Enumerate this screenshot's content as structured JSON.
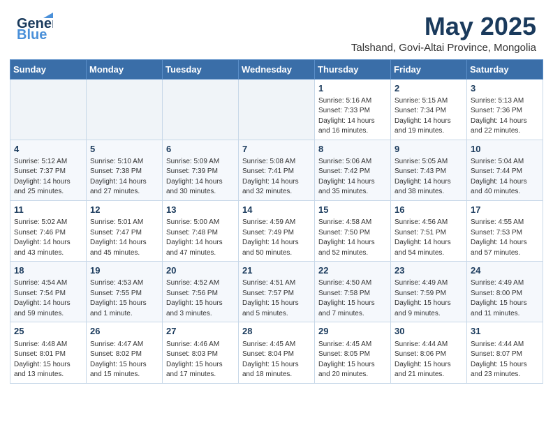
{
  "header": {
    "logo_general": "General",
    "logo_blue": "Blue",
    "month_title": "May 2025",
    "location": "Talshand, Govi-Altai Province, Mongolia"
  },
  "weekdays": [
    "Sunday",
    "Monday",
    "Tuesday",
    "Wednesday",
    "Thursday",
    "Friday",
    "Saturday"
  ],
  "weeks": [
    [
      {
        "day": "",
        "info": ""
      },
      {
        "day": "",
        "info": ""
      },
      {
        "day": "",
        "info": ""
      },
      {
        "day": "",
        "info": ""
      },
      {
        "day": "1",
        "info": "Sunrise: 5:16 AM\nSunset: 7:33 PM\nDaylight: 14 hours\nand 16 minutes."
      },
      {
        "day": "2",
        "info": "Sunrise: 5:15 AM\nSunset: 7:34 PM\nDaylight: 14 hours\nand 19 minutes."
      },
      {
        "day": "3",
        "info": "Sunrise: 5:13 AM\nSunset: 7:36 PM\nDaylight: 14 hours\nand 22 minutes."
      }
    ],
    [
      {
        "day": "4",
        "info": "Sunrise: 5:12 AM\nSunset: 7:37 PM\nDaylight: 14 hours\nand 25 minutes."
      },
      {
        "day": "5",
        "info": "Sunrise: 5:10 AM\nSunset: 7:38 PM\nDaylight: 14 hours\nand 27 minutes."
      },
      {
        "day": "6",
        "info": "Sunrise: 5:09 AM\nSunset: 7:39 PM\nDaylight: 14 hours\nand 30 minutes."
      },
      {
        "day": "7",
        "info": "Sunrise: 5:08 AM\nSunset: 7:41 PM\nDaylight: 14 hours\nand 32 minutes."
      },
      {
        "day": "8",
        "info": "Sunrise: 5:06 AM\nSunset: 7:42 PM\nDaylight: 14 hours\nand 35 minutes."
      },
      {
        "day": "9",
        "info": "Sunrise: 5:05 AM\nSunset: 7:43 PM\nDaylight: 14 hours\nand 38 minutes."
      },
      {
        "day": "10",
        "info": "Sunrise: 5:04 AM\nSunset: 7:44 PM\nDaylight: 14 hours\nand 40 minutes."
      }
    ],
    [
      {
        "day": "11",
        "info": "Sunrise: 5:02 AM\nSunset: 7:46 PM\nDaylight: 14 hours\nand 43 minutes."
      },
      {
        "day": "12",
        "info": "Sunrise: 5:01 AM\nSunset: 7:47 PM\nDaylight: 14 hours\nand 45 minutes."
      },
      {
        "day": "13",
        "info": "Sunrise: 5:00 AM\nSunset: 7:48 PM\nDaylight: 14 hours\nand 47 minutes."
      },
      {
        "day": "14",
        "info": "Sunrise: 4:59 AM\nSunset: 7:49 PM\nDaylight: 14 hours\nand 50 minutes."
      },
      {
        "day": "15",
        "info": "Sunrise: 4:58 AM\nSunset: 7:50 PM\nDaylight: 14 hours\nand 52 minutes."
      },
      {
        "day": "16",
        "info": "Sunrise: 4:56 AM\nSunset: 7:51 PM\nDaylight: 14 hours\nand 54 minutes."
      },
      {
        "day": "17",
        "info": "Sunrise: 4:55 AM\nSunset: 7:53 PM\nDaylight: 14 hours\nand 57 minutes."
      }
    ],
    [
      {
        "day": "18",
        "info": "Sunrise: 4:54 AM\nSunset: 7:54 PM\nDaylight: 14 hours\nand 59 minutes."
      },
      {
        "day": "19",
        "info": "Sunrise: 4:53 AM\nSunset: 7:55 PM\nDaylight: 15 hours\nand 1 minute."
      },
      {
        "day": "20",
        "info": "Sunrise: 4:52 AM\nSunset: 7:56 PM\nDaylight: 15 hours\nand 3 minutes."
      },
      {
        "day": "21",
        "info": "Sunrise: 4:51 AM\nSunset: 7:57 PM\nDaylight: 15 hours\nand 5 minutes."
      },
      {
        "day": "22",
        "info": "Sunrise: 4:50 AM\nSunset: 7:58 PM\nDaylight: 15 hours\nand 7 minutes."
      },
      {
        "day": "23",
        "info": "Sunrise: 4:49 AM\nSunset: 7:59 PM\nDaylight: 15 hours\nand 9 minutes."
      },
      {
        "day": "24",
        "info": "Sunrise: 4:49 AM\nSunset: 8:00 PM\nDaylight: 15 hours\nand 11 minutes."
      }
    ],
    [
      {
        "day": "25",
        "info": "Sunrise: 4:48 AM\nSunset: 8:01 PM\nDaylight: 15 hours\nand 13 minutes."
      },
      {
        "day": "26",
        "info": "Sunrise: 4:47 AM\nSunset: 8:02 PM\nDaylight: 15 hours\nand 15 minutes."
      },
      {
        "day": "27",
        "info": "Sunrise: 4:46 AM\nSunset: 8:03 PM\nDaylight: 15 hours\nand 17 minutes."
      },
      {
        "day": "28",
        "info": "Sunrise: 4:45 AM\nSunset: 8:04 PM\nDaylight: 15 hours\nand 18 minutes."
      },
      {
        "day": "29",
        "info": "Sunrise: 4:45 AM\nSunset: 8:05 PM\nDaylight: 15 hours\nand 20 minutes."
      },
      {
        "day": "30",
        "info": "Sunrise: 4:44 AM\nSunset: 8:06 PM\nDaylight: 15 hours\nand 21 minutes."
      },
      {
        "day": "31",
        "info": "Sunrise: 4:44 AM\nSunset: 8:07 PM\nDaylight: 15 hours\nand 23 minutes."
      }
    ]
  ]
}
